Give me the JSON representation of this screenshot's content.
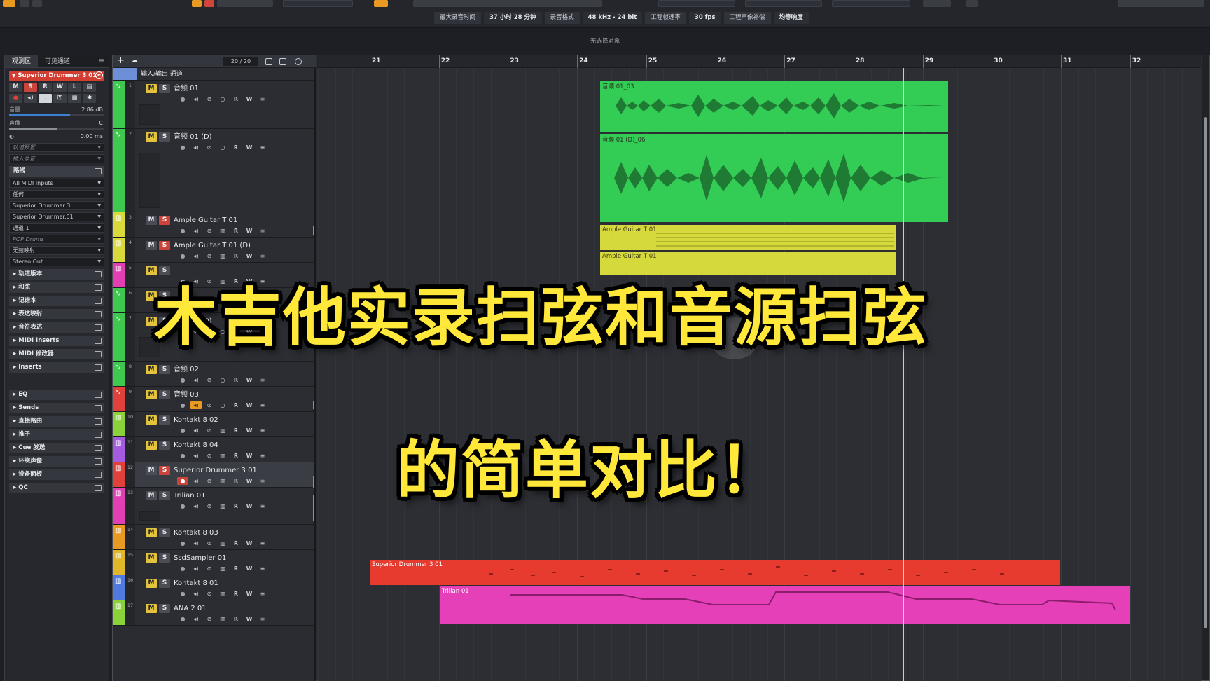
{
  "toolbar": {
    "status": [
      {
        "label": "最大录音时间",
        "value": "37 小时 28 分钟"
      },
      {
        "label": "录音格式",
        "value": "48 kHz - 24 bit"
      },
      {
        "label": "工程帧速率",
        "value": "30 fps"
      },
      {
        "label": "工程声像补偿",
        "value": "均等响度"
      }
    ],
    "no_selection": "无选择对象",
    "accent_color": "#e89a23"
  },
  "inspector": {
    "tabs": [
      "观测区",
      "可见通道"
    ],
    "track_name": "Superior Drummer 3 01",
    "buttons_row1": [
      "M",
      "S",
      "R",
      "W",
      "L"
    ],
    "volume_label": "音量",
    "volume_value": "2.86 dB",
    "pan_label": "声像",
    "pan_value": "C",
    "delay_value": "0.00 ms",
    "preset_placeholder": "轨道预置...",
    "insert_placeholder": "插入录音...",
    "routing_section": "路线",
    "midi_input": "All MIDI Inputs",
    "channel_any": "任何",
    "instrument": "Superior Drummer 3",
    "instrument_out": "Superior Drummer.01",
    "midi_channel": "通道 1",
    "drum_map": "POP Drums",
    "no_map": "无鼓映射",
    "output": "Stereo Out",
    "sections": [
      "轨道版本",
      "和弦",
      "记谱本",
      "表达映射",
      "音符表达",
      "MIDI Inserts",
      "MIDI 修改器",
      "Inserts",
      "EQ",
      "Sends",
      "直接路由",
      "推子",
      "Cue 发送",
      "环绕声像",
      "设备面板",
      "QC"
    ]
  },
  "project": {
    "track_count": "20 / 20",
    "io_folder_label": "输入/输出 通道",
    "tracks": [
      {
        "num": "1",
        "name": "音频 01",
        "color": "#3ec84f",
        "m_on": true,
        "s_on": false,
        "type": "audio"
      },
      {
        "num": "2",
        "name": "音频 01 (D)",
        "color": "#3ec84f",
        "m_on": true,
        "s_on": false,
        "type": "audio"
      },
      {
        "num": "3",
        "name": "Ample Guitar T 01",
        "color": "#d8d93a",
        "m_on": false,
        "s_on": true,
        "type": "inst"
      },
      {
        "num": "4",
        "name": "Ample Guitar T 01 (D)",
        "color": "#d8d93a",
        "m_on": false,
        "s_on": true,
        "type": "inst"
      },
      {
        "num": "5",
        "name": "",
        "color": "#e23fb4",
        "m_on": true,
        "s_on": false,
        "type": "inst"
      },
      {
        "num": "6",
        "name": "",
        "color": "#3ec84f",
        "m_on": true,
        "s_on": false,
        "type": "audio"
      },
      {
        "num": "7",
        "name": "音频 01 (D)",
        "color": "#3ec84f",
        "m_on": true,
        "s_on": false,
        "type": "audio"
      },
      {
        "num": "8",
        "name": "音频 02",
        "color": "#3ec84f",
        "m_on": true,
        "s_on": false,
        "type": "audio"
      },
      {
        "num": "9",
        "name": "音频 03",
        "color": "#e0413a",
        "m_on": true,
        "s_on": false,
        "type": "audio"
      },
      {
        "num": "10",
        "name": "Kontakt 8 02",
        "color": "#8bd23a",
        "m_on": true,
        "s_on": false,
        "type": "inst"
      },
      {
        "num": "11",
        "name": "Kontakt 8 04",
        "color": "#a45be0",
        "m_on": true,
        "s_on": false,
        "type": "inst"
      },
      {
        "num": "12",
        "name": "Superior Drummer 3 01",
        "color": "#e0413a",
        "m_on": false,
        "s_on": true,
        "type": "inst"
      },
      {
        "num": "13",
        "name": "Trilian 01",
        "color": "#e23fb4",
        "m_on": false,
        "s_on": false,
        "type": "inst"
      },
      {
        "num": "14",
        "name": "Kontakt 8 03",
        "color": "#e89a23",
        "m_on": true,
        "s_on": false,
        "type": "inst"
      },
      {
        "num": "15",
        "name": "SsdSampler 01",
        "color": "#e0b62a",
        "m_on": true,
        "s_on": false,
        "type": "inst"
      },
      {
        "num": "16",
        "name": "Kontakt 8 01",
        "color": "#4f7be0",
        "m_on": true,
        "s_on": false,
        "type": "inst"
      },
      {
        "num": "17",
        "name": "ANA 2 01",
        "color": "#8bd23a",
        "m_on": true,
        "s_on": false,
        "type": "inst"
      }
    ],
    "bars": [
      "21",
      "22",
      "23",
      "24",
      "25",
      "26",
      "27",
      "28",
      "29",
      "30",
      "31",
      "32"
    ],
    "events": [
      {
        "name": "音频 01_03",
        "color": "#33cc55"
      },
      {
        "name": "音频 01 (D)_06",
        "color": "#33cc55"
      },
      {
        "name": "Ample Guitar T 01",
        "color": "#d6d93b"
      },
      {
        "name": "Ample Guitar T 01",
        "color": "#d6d93b"
      },
      {
        "name": "Superior Drummer 3 01",
        "color": "#e63b2e"
      },
      {
        "name": "Trilian 01",
        "color": "#e640b8"
      }
    ]
  },
  "captions": {
    "line1": "木吉他实录扫弦和音源扫弦",
    "line2": "的简单对比！"
  }
}
